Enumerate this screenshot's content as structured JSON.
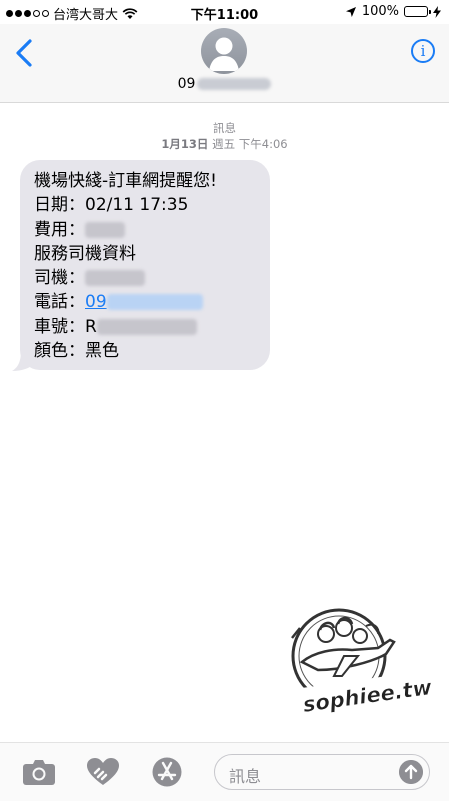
{
  "status_bar": {
    "carrier": "台湾大哥大",
    "time": "下午11:00",
    "battery": "100%"
  },
  "header": {
    "contact_prefix": "09",
    "info_icon_label": "i"
  },
  "meta": {
    "label": "訊息",
    "date": "1月13日",
    "weekday_time": "週五 下午4:06"
  },
  "message": {
    "line1": "機場快綫-訂車網提醒您!",
    "line2_label": "日期：",
    "line2_value": "02/11 17:35",
    "line3_label": "費用：",
    "line4": "服務司機資料",
    "line5_label": "司機：",
    "line6_label": "電話：",
    "line6_link": "09",
    "line7_label": "車號：",
    "line7_value": "R",
    "line8": "顏色：黑色"
  },
  "watermark": {
    "text": "sophiee.tw"
  },
  "input": {
    "placeholder": "訊息"
  },
  "colors": {
    "accent": "#1a7cf5",
    "bubble": "#e6e5eb"
  }
}
